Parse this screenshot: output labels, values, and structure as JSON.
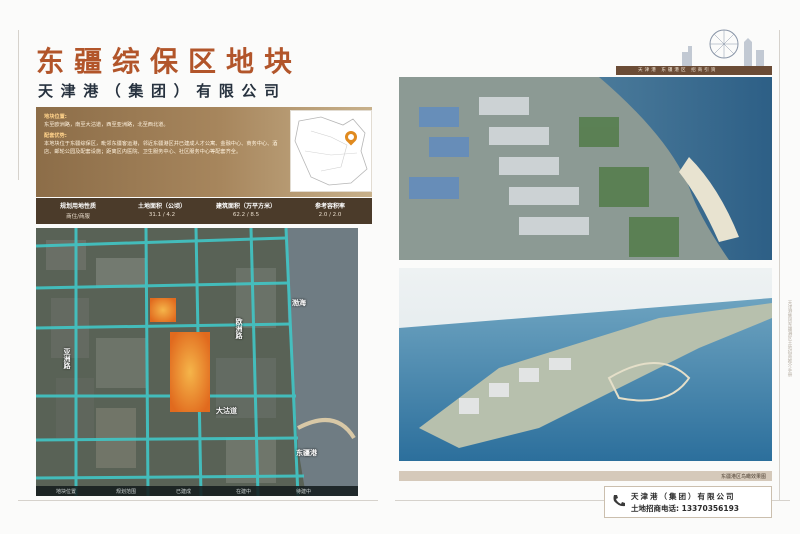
{
  "left": {
    "title": "东疆综保区地块",
    "subtitle": "天津港（集团）有限公司",
    "info": {
      "location_heading": "地块位置:",
      "location_text": "东至欧洲路，南至大沽道，西至亚洲路，北至西北道。",
      "advantage_heading": "配套优势:",
      "advantage_text": "本地块位于东疆综保区，毗邻东疆客运港，邻近东疆港区并已建成人才公寓、金融中心、商务中心、酒店、邮轮公园及配套设施；距离区内医院、卫生服务中心、社区服务中心等配套齐全。"
    },
    "table": {
      "headers": [
        "规划用地性质",
        "土地面积（公顷）",
        "建筑面积（万平方米）",
        "参考容积率"
      ],
      "values": [
        "商住/商服",
        "31.1 / 4.2",
        "62.2 / 8.5",
        "2.0 / 2.0"
      ]
    },
    "map_labels": {
      "sea": "渤海",
      "road_a": "亚洲路",
      "road_b": "欧洲路",
      "road_c": "大沽道",
      "park": "东疆港"
    },
    "legend": [
      "地块位置",
      "规划范围",
      "已建成",
      "在建中",
      "待建中"
    ]
  },
  "right": {
    "brand_text": "天津港 东疆港区 招商引资",
    "caption": "东疆港区鸟瞰效果图",
    "contact": {
      "company": "天津港（集团）有限公司",
      "phone_label": "土地招商电话:",
      "phone": "13370356193"
    },
    "vertical_note": "天津港集团东疆港区土地招商推介手册"
  },
  "colors": {
    "title": "#b2552a",
    "info_bg": "#a7865d",
    "table_bg": "#4b3b2a",
    "plot": "#e9892e"
  }
}
